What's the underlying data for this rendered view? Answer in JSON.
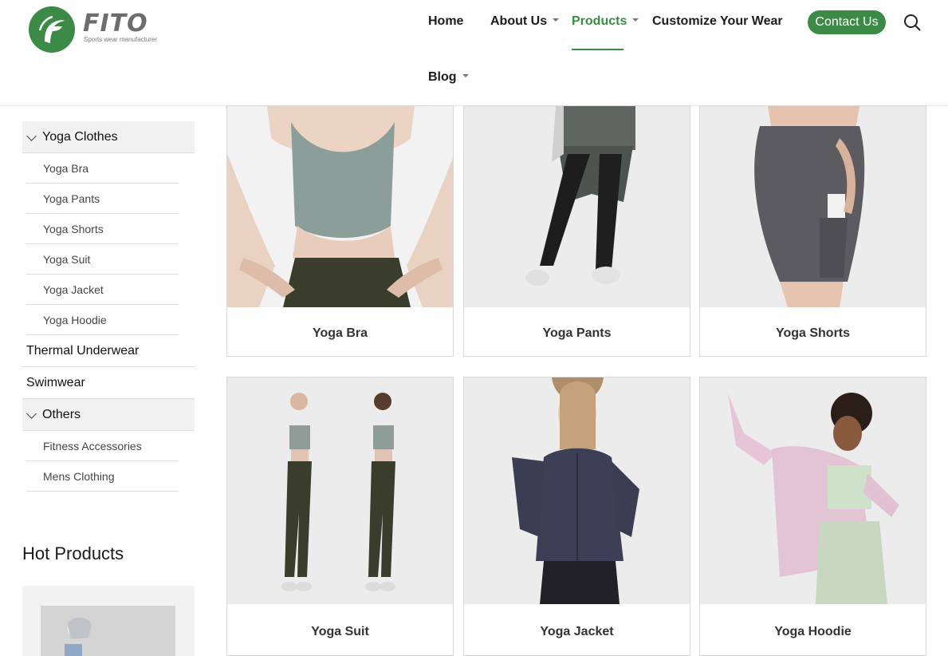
{
  "brand": {
    "name": "FITO",
    "tagline": "Sports wear manufacturer",
    "accent_color": "#3b8a45",
    "icon": "fito-logo-icon"
  },
  "nav": {
    "home": "Home",
    "about": "About Us",
    "products": "Products",
    "customize": "Customize Your Wear",
    "blog": "Blog",
    "contact": "Contact Us",
    "active": "Products",
    "search_icon": "search-icon"
  },
  "sidebar": {
    "yoga_clothes": {
      "label": "Yoga Clothes",
      "expanded": true,
      "items": [
        "Yoga Bra",
        "Yoga Pants",
        "Yoga Shorts",
        "Yoga Suit",
        "Yoga Jacket",
        "Yoga Hoodie"
      ]
    },
    "thermal": "Thermal Underwear",
    "swimwear": "Swimwear",
    "others": {
      "label": "Others",
      "expanded": true,
      "items": [
        "Fitness Accessories",
        "Mens Clothing"
      ]
    }
  },
  "hot_products": {
    "title": "Hot Products"
  },
  "products": [
    {
      "name": "Yoga Bra"
    },
    {
      "name": "Yoga Pants"
    },
    {
      "name": "Yoga Shorts"
    },
    {
      "name": "Yoga Suit"
    },
    {
      "name": "Yoga Jacket"
    },
    {
      "name": "Yoga Hoodie"
    }
  ]
}
